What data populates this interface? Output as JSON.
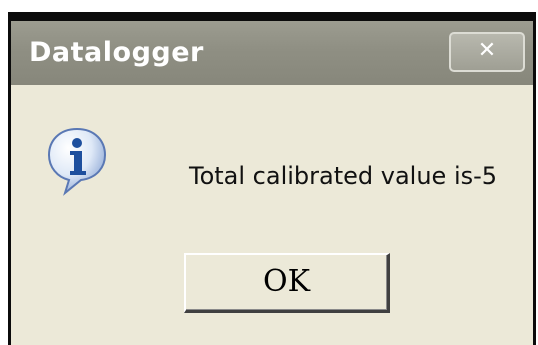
{
  "dialog": {
    "title": "Datalogger",
    "close_label": "✕",
    "message": "Total calibrated value is-5",
    "ok_label": "OK",
    "icon": "info-icon"
  },
  "colors": {
    "titlebar": "#8f8f83",
    "client_background": "#ece9d8",
    "icon_blue": "#2a5fb0"
  }
}
